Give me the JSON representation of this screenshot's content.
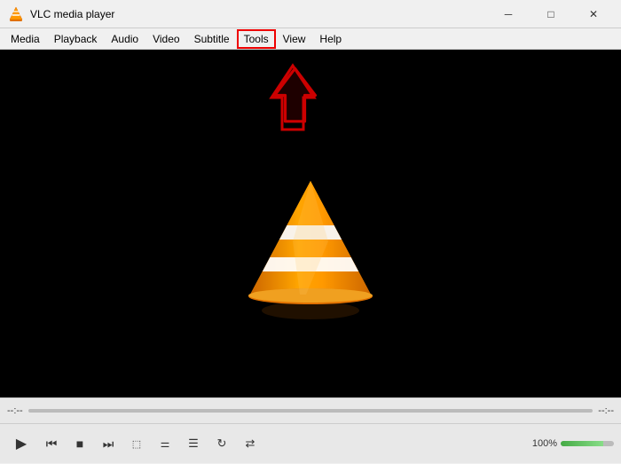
{
  "titleBar": {
    "icon": "vlc",
    "title": "VLC media player",
    "minimize": "─",
    "maximize": "□",
    "close": "✕"
  },
  "menuBar": {
    "items": [
      "Media",
      "Playback",
      "Audio",
      "Video",
      "Subtitle",
      "Tools",
      "View",
      "Help"
    ],
    "highlighted": "Tools"
  },
  "controls": {
    "timeLeft": "--:--",
    "timeRight": "--:--",
    "playButton": "▶",
    "prevFrameBtn": "⏮",
    "stopBtn": "■",
    "nextFrameBtn": "⏭",
    "frameByFrameBtn": "⬜",
    "eqBtn": "⚙",
    "playlistBtn": "☰",
    "loopBtn": "↻",
    "shuffleBtn": "⇄",
    "volumeLabel": "100%"
  }
}
